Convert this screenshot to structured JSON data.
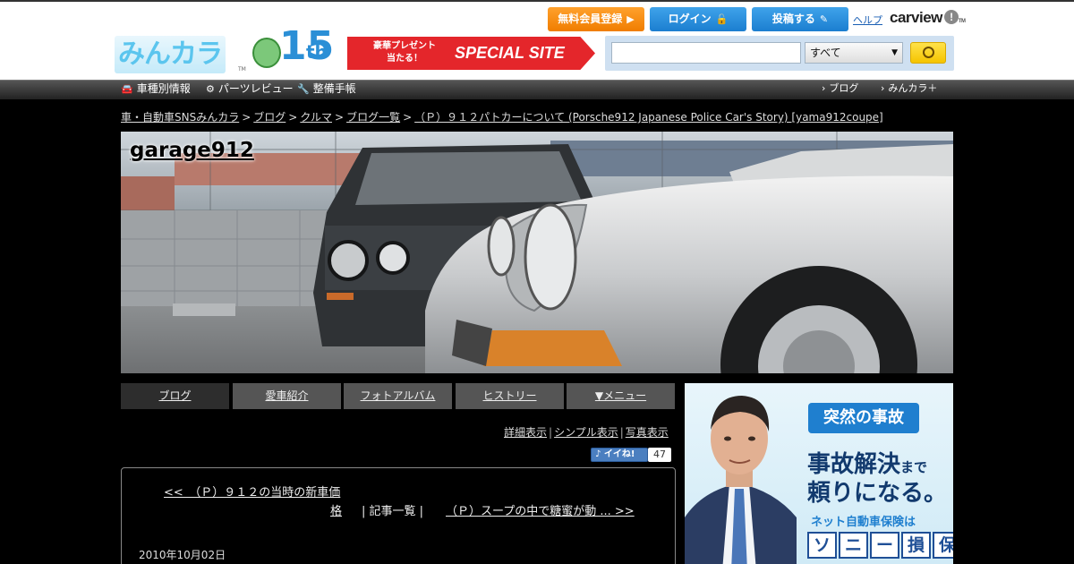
{
  "header": {
    "logo": "みんカラ",
    "logo_tm": "TM",
    "anniversary_num": "15",
    "anniversary_suffix": "th",
    "banner_small": "豪華プレゼント 当たる！",
    "banner_big": "SPECIAL SITE",
    "register_label": "無料会員登録",
    "login_label": "ログイン",
    "post_label": "投稿する",
    "help_label": "ヘルプ",
    "carview_label": "carview",
    "carview_bang": "!",
    "carview_tm": "TM"
  },
  "search": {
    "input_value": "",
    "select_value": "すべて"
  },
  "global_nav": {
    "left": [
      "車種別情報",
      "パーツレビュー",
      "整備手帳"
    ],
    "right": [
      "ブログ",
      "みんカラ＋"
    ]
  },
  "breadcrumb": {
    "items": [
      "車・自動車SNSみんカラ",
      "ブログ",
      "クルマ",
      "ブログ一覧",
      "（Ｐ）９１２パトカーについて (Porsche912 Japanese Police Car's Story) [yama912coupe]"
    ],
    "separator": ">"
  },
  "blog": {
    "title": "garage912",
    "tabs": [
      "ブログ",
      "愛車紹介",
      "フォトアルバム",
      "ヒストリー",
      "▼メニュー"
    ]
  },
  "view_modes": {
    "items": [
      "詳細表示",
      "シンプル表示",
      "写真表示"
    ],
    "separator": "|"
  },
  "like": {
    "label": "イイね!",
    "count": "47"
  },
  "entry": {
    "prev_line1": "<<　（Ｐ）９１２の当時の新車価",
    "prev_line2": "格",
    "list_link": "| 記事一覧 |",
    "next": "（Ｐ）スープの中で糖蜜が動 ... >>",
    "date": "2010年10月02日"
  },
  "ad": {
    "badge": "突然の事故",
    "line1_big": "事故解決",
    "line1_small": "まで",
    "line2": "頼りになる。",
    "line3": "ネット自動車保険は",
    "brand_chars": [
      "ソ",
      "ニ",
      "ー",
      "損",
      "保"
    ]
  },
  "colors": {
    "register_orange": "#f07d00",
    "login_blue": "#1b7ed0",
    "banner_red": "#e4262b",
    "search_bar": "#cfe0f1"
  }
}
